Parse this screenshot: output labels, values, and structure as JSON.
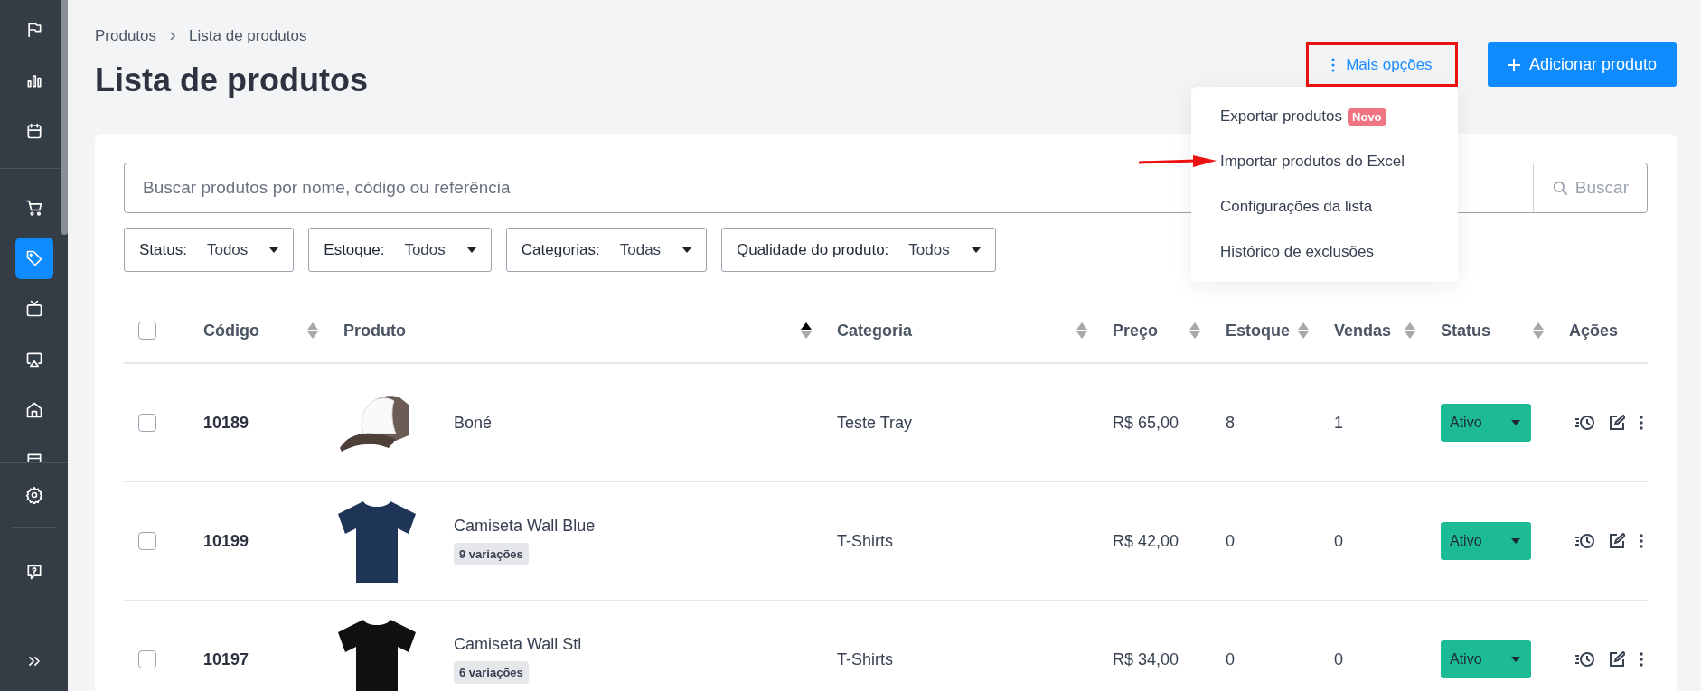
{
  "sidebar": {
    "sections": [
      {
        "items": [
          {
            "selected": false
          },
          {
            "selected": false
          },
          {
            "selected": false
          }
        ]
      },
      {
        "items": [
          {
            "selected": false
          },
          {
            "selected": true
          },
          {
            "selected": false
          },
          {
            "selected": false
          },
          {
            "selected": false
          },
          {
            "selected": false
          }
        ]
      },
      {
        "items": [
          {
            "selected": false
          }
        ]
      },
      {
        "items": [
          {
            "selected": false
          },
          {
            "selected": false
          }
        ]
      }
    ]
  },
  "breadcrumb": [
    "Produtos",
    "Lista de produtos"
  ],
  "title": "Lista de produtos",
  "more_button": {
    "label": "Mais opções",
    "highlighted": true
  },
  "add_button": {
    "label": "Adicionar produto"
  },
  "menu": {
    "open": true,
    "items": [
      {
        "label": "Exportar produtos",
        "badge": "Novo",
        "pointed": false
      },
      {
        "label": "Importar produtos do Excel",
        "pointed": true
      },
      {
        "label": "Configurações da lista",
        "pointed": false
      },
      {
        "label": "Histórico de exclusões",
        "pointed": false
      }
    ]
  },
  "search": {
    "placeholder": "Buscar produtos por nome, código ou referência",
    "button": "Buscar"
  },
  "filters": [
    {
      "label": "Status:",
      "value": "Todos"
    },
    {
      "label": "Estoque:",
      "value": "Todos"
    },
    {
      "label": "Categorias:",
      "value": "Todas"
    },
    {
      "label": "Qualidade do produto:",
      "value": "Todos"
    }
  ],
  "table": {
    "select_all": {
      "checked": false
    },
    "columns": [
      {
        "label": "Código",
        "sortable": true,
        "sorted": false
      },
      {
        "label": "Produto",
        "sortable": true,
        "sorted": true
      },
      {
        "label": "Categoria",
        "sortable": true,
        "sorted": false
      },
      {
        "label": "Preço",
        "sortable": true,
        "sorted": false
      },
      {
        "label": "Estoque",
        "sortable": true,
        "sorted": false
      },
      {
        "label": "Vendas",
        "sortable": true,
        "sorted": false
      },
      {
        "label": "Status",
        "sortable": true,
        "sorted": false
      },
      {
        "label": "Ações",
        "sortable": false
      }
    ],
    "rows": [
      {
        "checked": false,
        "code": "10189",
        "name": "Boné",
        "category": "Teste Tray",
        "price": "R$ 65,00",
        "stock": "8",
        "sales": "1",
        "status": "Ativo"
      },
      {
        "checked": false,
        "code": "10199",
        "name": "Camiseta Wall Blue",
        "variations": "9 variações",
        "category": "T-Shirts",
        "price": "R$ 42,00",
        "stock": "0",
        "sales": "0",
        "status": "Ativo"
      },
      {
        "checked": false,
        "code": "10197",
        "name": "Camiseta Wall Stl",
        "variations": "6 variações",
        "category": "T-Shirts",
        "price": "R$ 34,00",
        "stock": "0",
        "sales": "0",
        "status": "Ativo"
      }
    ]
  }
}
